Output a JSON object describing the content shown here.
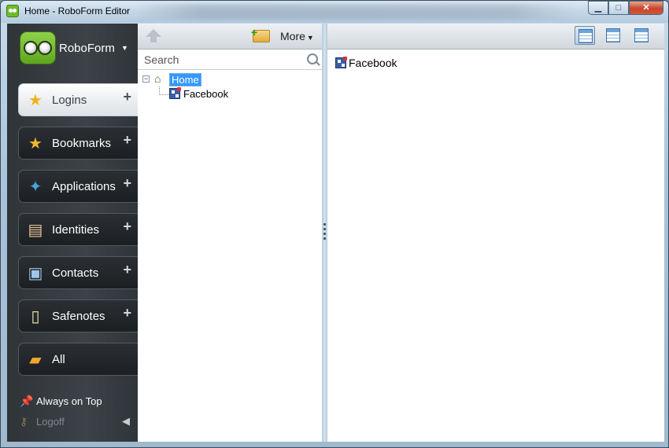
{
  "window": {
    "title": "Home - RoboForm Editor",
    "controls": {
      "minimize": "▁",
      "maximize": "□",
      "close": "✕"
    }
  },
  "sidebar": {
    "brand": "RoboForm",
    "items": [
      {
        "label": "Logins",
        "icon": "logins-icon",
        "active": true
      },
      {
        "label": "Bookmarks",
        "icon": "bookmarks-icon"
      },
      {
        "label": "Applications",
        "icon": "applications-icon"
      },
      {
        "label": "Identities",
        "icon": "identities-icon"
      },
      {
        "label": "Contacts",
        "icon": "contacts-icon"
      },
      {
        "label": "Safenotes",
        "icon": "safenotes-icon"
      },
      {
        "label": "All",
        "icon": "all-icon"
      }
    ],
    "footer": {
      "always_on_top": "Always on Top",
      "logoff": "Logoff"
    }
  },
  "tree_panel": {
    "more_label": "More",
    "search_placeholder": "Search",
    "tree": {
      "root": "Home",
      "children": [
        "Facebook"
      ]
    }
  },
  "content_panel": {
    "items": [
      "Facebook"
    ]
  },
  "colors": {
    "selection": "#3399ff",
    "sidebar_bg": "#3c4247",
    "brand_green": "#6dbb2c"
  }
}
